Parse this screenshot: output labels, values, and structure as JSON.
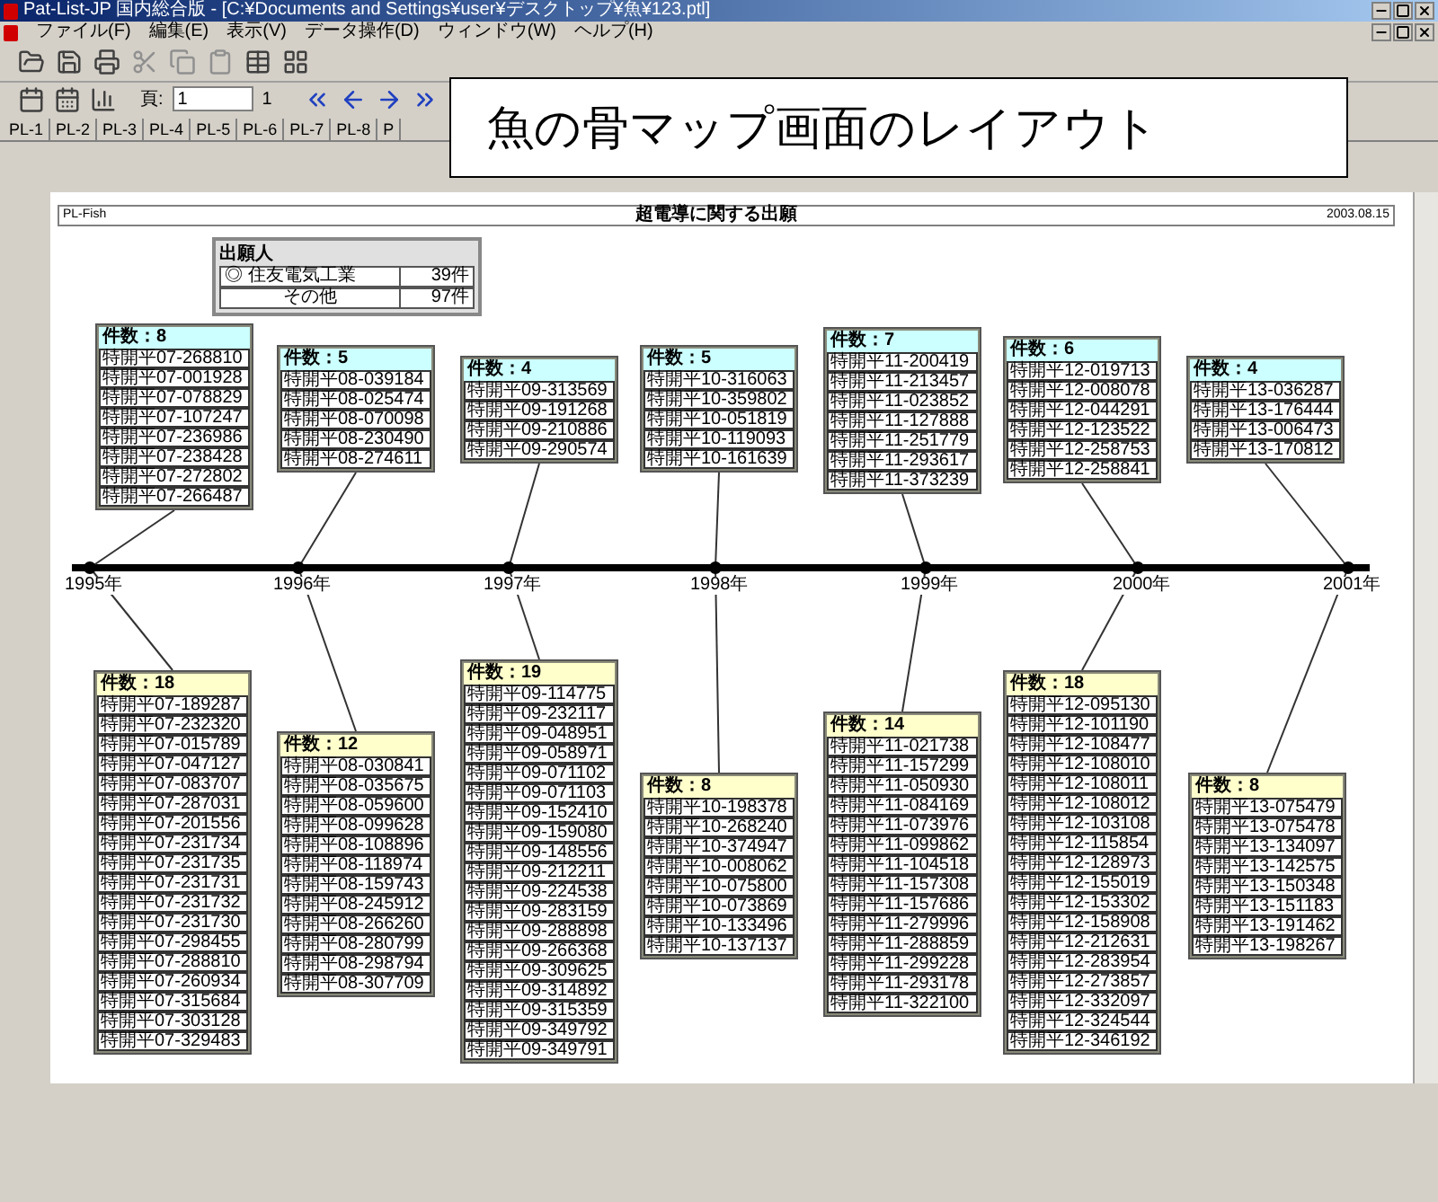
{
  "window": {
    "title": "Pat-List-JP 国内総合版 - [C:¥Documents and Settings¥user¥デスクトップ¥魚¥123.ptl]"
  },
  "menu": [
    "ファイル(F)",
    "編集(E)",
    "表示(V)",
    "データ操作(D)",
    "ウィンドウ(W)",
    "ヘルプ(H)"
  ],
  "page_field": {
    "label": "頁:",
    "value": "1"
  },
  "page_count": "1",
  "tabs": [
    "PL-1",
    "PL-2",
    "PL-3",
    "PL-4",
    "PL-5",
    "PL-6",
    "PL-7",
    "PL-8",
    "P"
  ],
  "callout": "魚の骨マップ画面のレイアウト",
  "report": {
    "code": "PL-Fish",
    "title": "超電導に関する出願",
    "date": "2003.08.15"
  },
  "legend": {
    "title": "出願人",
    "rows": [
      {
        "name": "◎ 住友電気工業",
        "count": "39件"
      },
      {
        "name": "その他",
        "count": "97件"
      }
    ]
  },
  "timeline": [
    {
      "year": "1995年",
      "upper": {
        "count": "件数：8",
        "items": [
          "特開平07-268810",
          "特開平07-001928",
          "特開平07-078829",
          "特開平07-107247",
          "特開平07-236986",
          "特開平07-238428",
          "特開平07-272802",
          "特開平07-266487"
        ]
      },
      "lower": {
        "count": "件数：18",
        "items": [
          "特開平07-189287",
          "特開平07-232320",
          "特開平07-015789",
          "特開平07-047127",
          "特開平07-083707",
          "特開平07-287031",
          "特開平07-201556",
          "特開平07-231734",
          "特開平07-231735",
          "特開平07-231731",
          "特開平07-231732",
          "特開平07-231730",
          "特開平07-298455",
          "特開平07-288810",
          "特開平07-260934",
          "特開平07-315684",
          "特開平07-303128",
          "特開平07-329483"
        ]
      }
    },
    {
      "year": "1996年",
      "upper": {
        "count": "件数：5",
        "items": [
          "特開平08-039184",
          "特開平08-025474",
          "特開平08-070098",
          "特開平08-230490",
          "特開平08-274611"
        ]
      },
      "lower": {
        "count": "件数：12",
        "items": [
          "特開平08-030841",
          "特開平08-035675",
          "特開平08-059600",
          "特開平08-099628",
          "特開平08-108896",
          "特開平08-118974",
          "特開平08-159743",
          "特開平08-245912",
          "特開平08-266260",
          "特開平08-280799",
          "特開平08-298794",
          "特開平08-307709"
        ]
      }
    },
    {
      "year": "1997年",
      "upper": {
        "count": "件数：4",
        "items": [
          "特開平09-313569",
          "特開平09-191268",
          "特開平09-210886",
          "特開平09-290574"
        ]
      },
      "lower": {
        "count": "件数：19",
        "items": [
          "特開平09-114775",
          "特開平09-232117",
          "特開平09-048951",
          "特開平09-058971",
          "特開平09-071102",
          "特開平09-071103",
          "特開平09-152410",
          "特開平09-159080",
          "特開平09-148556",
          "特開平09-212211",
          "特開平09-224538",
          "特開平09-283159",
          "特開平09-288898",
          "特開平09-266368",
          "特開平09-309625",
          "特開平09-314892",
          "特開平09-315359",
          "特開平09-349792",
          "特開平09-349791"
        ]
      }
    },
    {
      "year": "1998年",
      "upper": {
        "count": "件数：5",
        "items": [
          "特開平10-316063",
          "特開平10-359802",
          "特開平10-051819",
          "特開平10-119093",
          "特開平10-161639"
        ]
      },
      "lower": {
        "count": "件数：8",
        "items": [
          "特開平10-198378",
          "特開平10-268240",
          "特開平10-374947",
          "特開平10-008062",
          "特開平10-075800",
          "特開平10-073869",
          "特開平10-133496",
          "特開平10-137137"
        ]
      }
    },
    {
      "year": "1999年",
      "upper": {
        "count": "件数：7",
        "items": [
          "特開平11-200419",
          "特開平11-213457",
          "特開平11-023852",
          "特開平11-127888",
          "特開平11-251779",
          "特開平11-293617",
          "特開平11-373239"
        ]
      },
      "lower": {
        "count": "件数：14",
        "items": [
          "特開平11-021738",
          "特開平11-157299",
          "特開平11-050930",
          "特開平11-084169",
          "特開平11-073976",
          "特開平11-099862",
          "特開平11-104518",
          "特開平11-157308",
          "特開平11-157686",
          "特開平11-279996",
          "特開平11-288859",
          "特開平11-299228",
          "特開平11-293178",
          "特開平11-322100"
        ]
      }
    },
    {
      "year": "2000年",
      "upper": {
        "count": "件数：6",
        "items": [
          "特開平12-019713",
          "特開平12-008078",
          "特開平12-044291",
          "特開平12-123522",
          "特開平12-258753",
          "特開平12-258841"
        ]
      },
      "lower": {
        "count": "件数：18",
        "items": [
          "特開平12-095130",
          "特開平12-101190",
          "特開平12-108477",
          "特開平12-108010",
          "特開平12-108011",
          "特開平12-108012",
          "特開平12-103108",
          "特開平12-115854",
          "特開平12-128973",
          "特開平12-155019",
          "特開平12-153302",
          "特開平12-158908",
          "特開平12-212631",
          "特開平12-283954",
          "特開平12-273857",
          "特開平12-332097",
          "特開平12-324544",
          "特開平12-346192"
        ]
      }
    },
    {
      "year": "2001年",
      "upper": {
        "count": "件数：4",
        "items": [
          "特開平13-036287",
          "特開平13-176444",
          "特開平13-006473",
          "特開平13-170812"
        ]
      },
      "lower": {
        "count": "件数：8",
        "items": [
          "特開平13-075479",
          "特開平13-075478",
          "特開平13-134097",
          "特開平13-142575",
          "特開平13-150348",
          "特開平13-151183",
          "特開平13-191462",
          "特開平13-198267"
        ]
      }
    }
  ]
}
